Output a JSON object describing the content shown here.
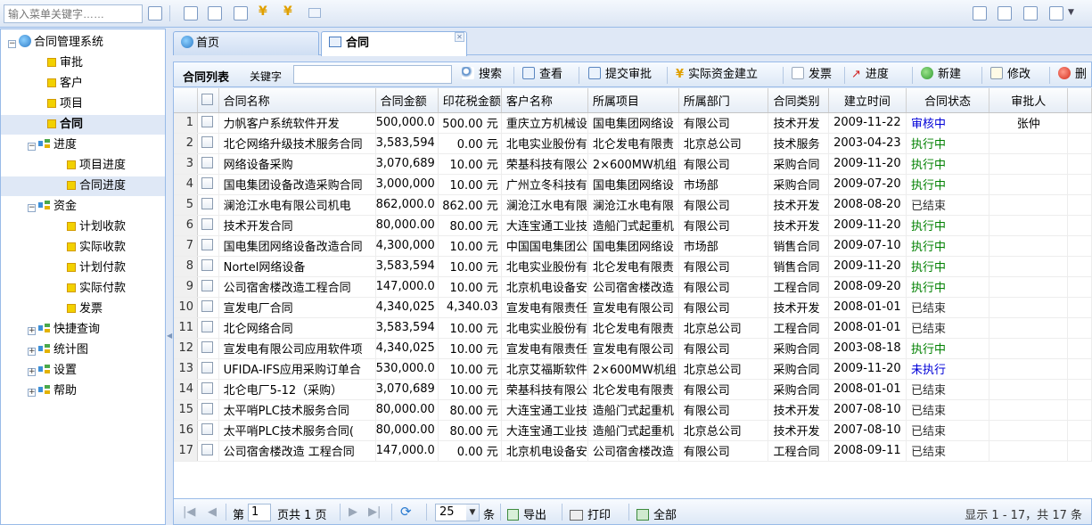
{
  "topbar": {
    "search_placeholder": "输入菜单关键字……"
  },
  "tree": {
    "root": "合同管理系统",
    "items": [
      {
        "label": "审批"
      },
      {
        "label": "客户"
      },
      {
        "label": "项目"
      },
      {
        "label": "合同"
      }
    ],
    "progress": {
      "label": "进度",
      "children": [
        "项目进度",
        "合同进度"
      ]
    },
    "funds": {
      "label": "资金",
      "children": [
        "计划收款",
        "实际收款",
        "计划付款",
        "实际付款",
        "发票"
      ]
    },
    "collapsed": [
      "快捷查询",
      "统计图",
      "设置",
      "帮助"
    ]
  },
  "tabs": {
    "home": "首页",
    "contract": "合同"
  },
  "toolbar": {
    "title": "合同列表",
    "keyword_label": "关键字",
    "buttons": [
      "搜索",
      "查看",
      "提交审批",
      "实际资金建立",
      "发票",
      "进度",
      "新建",
      "修改",
      "删"
    ]
  },
  "grid": {
    "columns": [
      "合同名称",
      "合同金额",
      "印花税金额",
      "客户名称",
      "所属项目",
      "所属部门",
      "合同类别",
      "建立时间",
      "合同状态",
      "审批人"
    ],
    "rows": [
      {
        "n": "1",
        "name": "力帆客户系统软件开发",
        "amount": "500,000.0",
        "tax": "500.00 元",
        "client": "重庆立方机械设",
        "project": "国电集团网络设",
        "dept": "有限公司",
        "type": "技术开发",
        "date": "2009-11-22",
        "status": "审核中",
        "approver": "张仲"
      },
      {
        "n": "2",
        "name": "北仑网络升级技术服务合同",
        "amount": "3,583,594",
        "tax": "0.00 元",
        "client": "北电实业股份有",
        "project": "北仑发电有限责",
        "dept": "北京总公司",
        "type": "技术服务",
        "date": "2003-04-23",
        "status": "执行中",
        "approver": ""
      },
      {
        "n": "3",
        "name": "网络设备采购",
        "amount": "3,070,689",
        "tax": "10.00 元",
        "client": "荣基科技有限公",
        "project": "2×600MW机组",
        "dept": "有限公司",
        "type": "采购合同",
        "date": "2009-11-20",
        "status": "执行中",
        "approver": ""
      },
      {
        "n": "4",
        "name": "国电集团设备改造采购合同",
        "amount": "3,000,000",
        "tax": "10.00 元",
        "client": "广州立冬科技有",
        "project": "国电集团网络设",
        "dept": "市场部",
        "type": "采购合同",
        "date": "2009-07-20",
        "status": "执行中",
        "approver": ""
      },
      {
        "n": "5",
        "name": "澜沧江水电有限公司机电",
        "amount": "862,000.0",
        "tax": "862.00 元",
        "client": "澜沧江水电有限",
        "project": "澜沧江水电有限",
        "dept": "有限公司",
        "type": "技术开发",
        "date": "2008-08-20",
        "status": "已结束",
        "approver": ""
      },
      {
        "n": "6",
        "name": "技术开发合同",
        "amount": "80,000.00",
        "tax": "80.00 元",
        "client": "大连宝通工业技",
        "project": "造船门式起重机",
        "dept": "有限公司",
        "type": "技术开发",
        "date": "2009-11-20",
        "status": "执行中",
        "approver": ""
      },
      {
        "n": "7",
        "name": "国电集团网络设备改造合同",
        "amount": "4,300,000",
        "tax": "10.00 元",
        "client": "中国国电集团公",
        "project": "国电集团网络设",
        "dept": "市场部",
        "type": "销售合同",
        "date": "2009-07-10",
        "status": "执行中",
        "approver": ""
      },
      {
        "n": "8",
        "name": "Nortel网络设备",
        "amount": "3,583,594",
        "tax": "10.00 元",
        "client": "北电实业股份有",
        "project": "北仑发电有限责",
        "dept": "有限公司",
        "type": "销售合同",
        "date": "2009-11-20",
        "status": "执行中",
        "approver": ""
      },
      {
        "n": "9",
        "name": "公司宿舍楼改造工程合同",
        "amount": "147,000.0",
        "tax": "10.00 元",
        "client": "北京机电设备安",
        "project": "公司宿舍楼改造",
        "dept": "有限公司",
        "type": "工程合同",
        "date": "2008-09-20",
        "status": "执行中",
        "approver": ""
      },
      {
        "n": "10",
        "name": "宣发电厂合同",
        "amount": "4,340,025",
        "tax": "4,340.03",
        "client": "宣发电有限责任",
        "project": "宣发电有限公司",
        "dept": "有限公司",
        "type": "技术开发",
        "date": "2008-01-01",
        "status": "已结束",
        "approver": ""
      },
      {
        "n": "11",
        "name": "北仑网络合同",
        "amount": "3,583,594",
        "tax": "10.00 元",
        "client": "北电实业股份有",
        "project": "北仑发电有限责",
        "dept": "北京总公司",
        "type": "工程合同",
        "date": "2008-01-01",
        "status": "已结束",
        "approver": ""
      },
      {
        "n": "12",
        "name": "宣发电有限公司应用软件项",
        "amount": "4,340,025",
        "tax": "10.00 元",
        "client": "宣发电有限责任",
        "project": "宣发电有限公司",
        "dept": "有限公司",
        "type": "采购合同",
        "date": "2003-08-18",
        "status": "执行中",
        "approver": ""
      },
      {
        "n": "13",
        "name": "UFIDA-IFS应用采购订单合",
        "amount": "530,000.0",
        "tax": "10.00 元",
        "client": "北京艾福斯软件",
        "project": "2×600MW机组",
        "dept": "北京总公司",
        "type": "采购合同",
        "date": "2009-11-20",
        "status": "未执行",
        "approver": ""
      },
      {
        "n": "14",
        "name": "北仑电厂5-12（采购）",
        "amount": "3,070,689",
        "tax": "10.00 元",
        "client": "荣基科技有限公",
        "project": "北仑发电有限责",
        "dept": "有限公司",
        "type": "采购合同",
        "date": "2008-01-01",
        "status": "已结束",
        "approver": ""
      },
      {
        "n": "15",
        "name": "太平哨PLC技术服务合同",
        "amount": "80,000.00",
        "tax": "80.00 元",
        "client": "大连宝通工业技",
        "project": "造船门式起重机",
        "dept": "有限公司",
        "type": "技术开发",
        "date": "2007-08-10",
        "status": "已结束",
        "approver": ""
      },
      {
        "n": "16",
        "name": "太平哨PLC技术服务合同(",
        "amount": "80,000.00",
        "tax": "80.00 元",
        "client": "大连宝通工业技",
        "project": "造船门式起重机",
        "dept": "北京总公司",
        "type": "技术开发",
        "date": "2007-08-10",
        "status": "已结束",
        "approver": ""
      },
      {
        "n": "17",
        "name": "公司宿舍楼改造 工程合同",
        "amount": "147,000.0",
        "tax": "0.00 元",
        "client": "北京机电设备安",
        "project": "公司宿舍楼改造",
        "dept": "有限公司",
        "type": "工程合同",
        "date": "2008-09-11",
        "status": "已结束",
        "approver": ""
      }
    ]
  },
  "pager": {
    "page_prefix": "第",
    "page_value": "1",
    "page_suffix": "页共 1 页",
    "page_size": "25",
    "page_size_unit": "条",
    "export": "导出",
    "print": "打印",
    "all": "全部",
    "summary": "显示 1 - 17，共 17 条"
  },
  "colors": {
    "panel_border": "#99bbe8",
    "status_reviewing": "#0000d8",
    "status_running": "#008000",
    "status_pending": "#0000d8",
    "status_done": "#333333"
  }
}
